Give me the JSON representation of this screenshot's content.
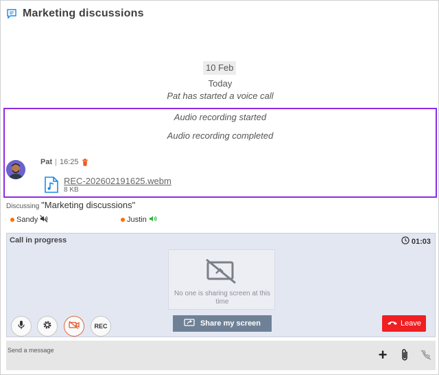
{
  "header": {
    "title": "Marketing discussions",
    "icon": "chat-bubble-icon"
  },
  "timeline": {
    "date_chip": "10 Feb",
    "today": "Today",
    "voice_call": "Pat has started a voice call",
    "recording_started": "Audio recording started",
    "recording_completed": "Audio recording completed"
  },
  "message": {
    "author": "Pat",
    "separator": "|",
    "time": "16:25",
    "file_name": "REC-202602191625.webm",
    "file_size": "8 KB"
  },
  "discussing": {
    "label": "Discussing",
    "topic": "\"Marketing discussions\""
  },
  "participants": [
    {
      "name": "Sandy",
      "status_color": "#ff6f00",
      "audio_icon": "audio-muted-icon"
    },
    {
      "name": "Justin",
      "status_color": "#ff6f00",
      "audio_icon": "audio-speaking-icon"
    }
  ],
  "call": {
    "label": "Call in progress",
    "timer": "01:03",
    "no_share_text": "No one is sharing screen at this time",
    "share_button": "Share my screen",
    "leave_button": "Leave",
    "rec_button": "REC"
  },
  "composer": {
    "placeholder": "Send a message"
  },
  "colors": {
    "highlight": "#8a2be2",
    "leave": "#ef1f22",
    "share": "#6f8196",
    "accent": "#1e88e5"
  }
}
